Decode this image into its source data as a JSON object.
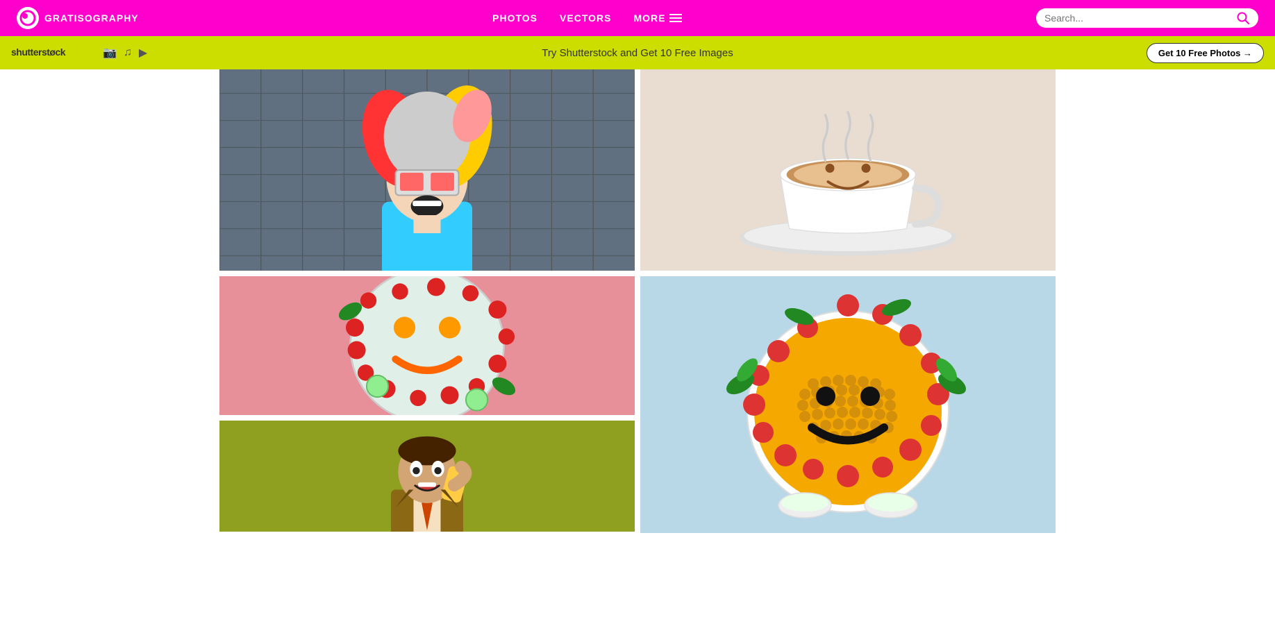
{
  "site": {
    "logo_text": "GRATISOGRAPHY",
    "nav": {
      "photos": "PHOTOS",
      "vectors": "VECTORS",
      "more": "MORE"
    },
    "search": {
      "placeholder": "Search..."
    }
  },
  "shutterstock_bar": {
    "logo": "shutterstock",
    "promo_text": "Try Shutterstock and Get 10 Free Images",
    "cta_label": "Get 10 Free Photos →"
  },
  "photos": [
    {
      "id": "clown",
      "alt": "Person with colorful curly wig and VR glasses screaming",
      "description": "Colorful clown with rainbow wig"
    },
    {
      "id": "coffee",
      "alt": "Coffee cup with smiley face latte art",
      "description": "Smiley coffee cup"
    },
    {
      "id": "food-plate",
      "alt": "Food arranged as smiley face on plate with tomatoes",
      "description": "Food smiley plate"
    },
    {
      "id": "soup-bowl",
      "alt": "Bowl of soup decorated as smiley face with tomatoes and herbs",
      "description": "Smiley soup bowl"
    },
    {
      "id": "man-phone",
      "alt": "Excited man in suit talking on phone",
      "description": "Excited man on phone"
    }
  ]
}
